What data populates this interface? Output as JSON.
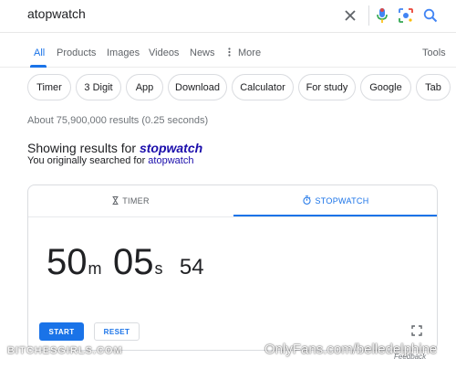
{
  "search": {
    "query": "atopwatch"
  },
  "nav_tabs": [
    {
      "label": "All",
      "active": true
    },
    {
      "label": "Products"
    },
    {
      "label": "Images"
    },
    {
      "label": "Videos"
    },
    {
      "label": "News"
    },
    {
      "label": "More",
      "icon": "more-vert-icon"
    },
    {
      "label": "Tools"
    }
  ],
  "chips": [
    "Timer",
    "3 Digit",
    "App",
    "Download",
    "Calculator",
    "For study",
    "Google",
    "Tab"
  ],
  "result_stats": "About 75,900,000 results (0.25 seconds)",
  "correction": {
    "showing_prefix": "Showing results for",
    "corrected_query": "stopwatch",
    "original_prefix": "You originally searched for",
    "original_query": "atopwatch"
  },
  "widget": {
    "tabs": [
      {
        "label": "TIMER",
        "icon": "hourglass-icon"
      },
      {
        "label": "STOPWATCH",
        "icon": "stopwatch-icon",
        "active": true
      }
    ],
    "minutes": "50",
    "minutes_unit": "m",
    "seconds": "05",
    "seconds_unit": "s",
    "hundredths": "54",
    "start_label": "START",
    "reset_label": "RESET",
    "feedback_label": "Feedback"
  },
  "watermarks": {
    "left": "BITCHESGIRLS.COM",
    "right": "OnlyFans.com/belledelphine"
  },
  "colors": {
    "accent": "#1a73e8",
    "link": "#1a0dab",
    "secondary_text": "#70757a"
  }
}
